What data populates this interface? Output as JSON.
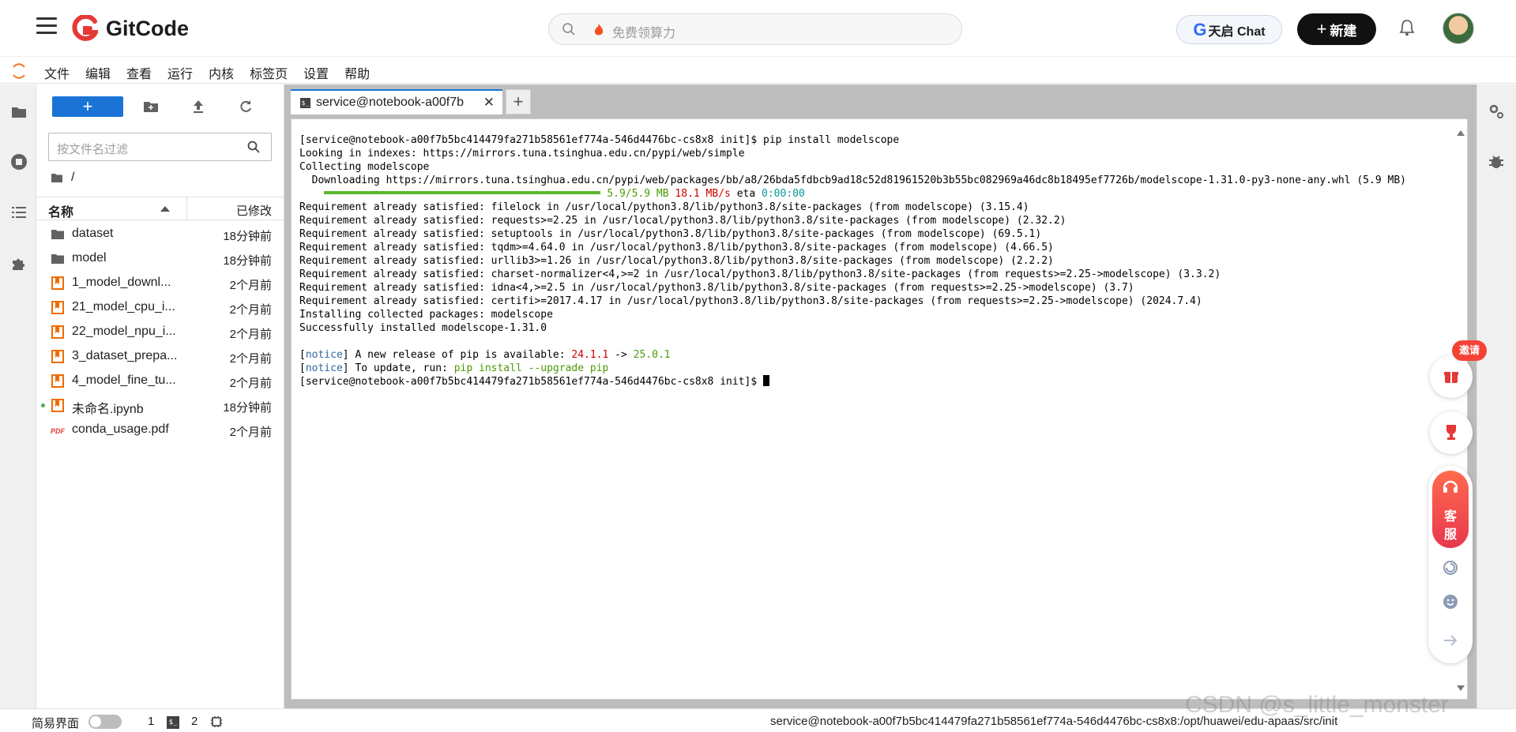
{
  "header": {
    "brand": "GitCode",
    "search_placeholder": "免费领算力",
    "chat_label": "天启 Chat",
    "new_label": "新建"
  },
  "menubar": {
    "items": [
      "文件",
      "编辑",
      "查看",
      "运行",
      "内核",
      "标签页",
      "设置",
      "帮助"
    ]
  },
  "filebrowser": {
    "filter_placeholder": "按文件名过滤",
    "path": "/",
    "col_name": "名称",
    "col_modified": "已修改",
    "files": [
      {
        "name": "dataset",
        "modified": "18分钟前",
        "type": "folder"
      },
      {
        "name": "model",
        "modified": "18分钟前",
        "type": "folder"
      },
      {
        "name": "1_model_downl...",
        "modified": "2个月前",
        "type": "notebook"
      },
      {
        "name": "21_model_cpu_i...",
        "modified": "2个月前",
        "type": "notebook"
      },
      {
        "name": "22_model_npu_i...",
        "modified": "2个月前",
        "type": "notebook"
      },
      {
        "name": "3_dataset_prepa...",
        "modified": "2个月前",
        "type": "notebook"
      },
      {
        "name": "4_model_fine_tu...",
        "modified": "2个月前",
        "type": "notebook"
      },
      {
        "name": "未命名.ipynb",
        "modified": "18分钟前",
        "type": "notebook",
        "running": true
      },
      {
        "name": "conda_usage.pdf",
        "modified": "2个月前",
        "type": "pdf"
      }
    ]
  },
  "tabs": {
    "active_label": "service@notebook-a00f7b",
    "add_label": "+"
  },
  "terminal": {
    "lines": [
      "[service@notebook-a00f7b5bc414479fa271b58561ef774a-546d4476bc-cs8x8 init]$ pip install modelscope",
      "Looking in indexes: https://mirrors.tuna.tsinghua.edu.cn/pypi/web/simple",
      "Collecting modelscope",
      "  Downloading https://mirrors.tuna.tsinghua.edu.cn/pypi/web/packages/bb/a8/26bda5fdbcb9ad18c52d81961520b3b55bc082969a46dc8b18495ef7726b/modelscope-1.31.0-py3-none-any.whl (5.9 MB)"
    ],
    "progress_size": "5.9/5.9 MB",
    "progress_speed": "18.1 MB/s",
    "progress_eta_label": "eta",
    "progress_eta": "0:00:00",
    "lines2": [
      "Requirement already satisfied: filelock in /usr/local/python3.8/lib/python3.8/site-packages (from modelscope) (3.15.4)",
      "Requirement already satisfied: requests>=2.25 in /usr/local/python3.8/lib/python3.8/site-packages (from modelscope) (2.32.2)",
      "Requirement already satisfied: setuptools in /usr/local/python3.8/lib/python3.8/site-packages (from modelscope) (69.5.1)",
      "Requirement already satisfied: tqdm>=4.64.0 in /usr/local/python3.8/lib/python3.8/site-packages (from modelscope) (4.66.5)",
      "Requirement already satisfied: urllib3>=1.26 in /usr/local/python3.8/lib/python3.8/site-packages (from modelscope) (2.2.2)",
      "Requirement already satisfied: charset-normalizer<4,>=2 in /usr/local/python3.8/lib/python3.8/site-packages (from requests>=2.25->modelscope) (3.3.2)",
      "Requirement already satisfied: idna<4,>=2.5 in /usr/local/python3.8/lib/python3.8/site-packages (from requests>=2.25->modelscope) (3.7)",
      "Requirement already satisfied: certifi>=2017.4.17 in /usr/local/python3.8/lib/python3.8/site-packages (from requests>=2.25->modelscope) (2024.7.4)",
      "Installing collected packages: modelscope",
      "Successfully installed modelscope-1.31.0"
    ],
    "notice_tag": "notice",
    "notice1_text": " A new release of pip is available: ",
    "notice1_old": "24.1.1",
    "notice1_arrow": " -> ",
    "notice1_new": "25.0.1",
    "notice2_text": " To update, run: ",
    "notice2_cmd": "pip install --upgrade pip",
    "prompt": "[service@notebook-a00f7b5bc414479fa271b58561ef774a-546d4476bc-cs8x8 init]$ "
  },
  "floating": {
    "invite_label": "邀请",
    "service_line1": "客",
    "service_line2": "服"
  },
  "statusbar": {
    "simple_mode_label": "简易界面",
    "count1": "1",
    "count2": "2",
    "path": "service@notebook-a00f7b5bc414479fa271b58561ef774a-546d4476bc-cs8x8:/opt/huawei/edu-apaas/src/init",
    "watermark": "CSDN @s_little_monster"
  },
  "colors": {
    "accent": "#1976d2",
    "new_button": "#1a73d5",
    "progress": "#5cb82a",
    "red": "#cc0000",
    "invite": "#f44336"
  }
}
